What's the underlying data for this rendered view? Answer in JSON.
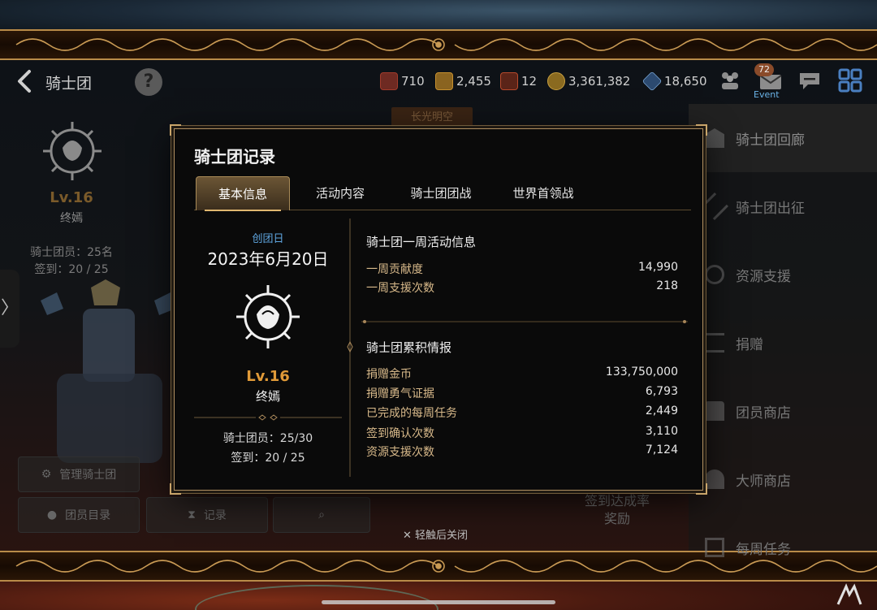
{
  "screen": {
    "back_icon": "chevron-left-icon",
    "title": "骑士团",
    "help_label": "?"
  },
  "resources": [
    {
      "icon": "energy-icon",
      "value": "710",
      "color": "#a23b2b"
    },
    {
      "icon": "crate-icon",
      "value": "2,455",
      "color": "#c7902e"
    },
    {
      "icon": "wave-icon",
      "value": "12",
      "color": "#b84a2c"
    },
    {
      "icon": "gold-coin-icon",
      "value": "3,361,382",
      "color": "#c9a040"
    },
    {
      "icon": "crystal-icon",
      "value": "18,650",
      "color": "#7aa7d6"
    }
  ],
  "topbar_icons": {
    "friends": "friends-icon",
    "mail": "mail-icon",
    "mail_badge": "72",
    "mail_event": "Event",
    "chat": "chat-icon",
    "menu": "grid-menu-icon"
  },
  "left_panel": {
    "level": "Lv.16",
    "name": "终嫣",
    "members": "骑士团员：25名",
    "checkin": "签到：20 / 25"
  },
  "bg_buttons": {
    "manage": "管理骑士团",
    "members": "团员目录",
    "records": "记录",
    "reward": "签到达成率\n奖励",
    "banner": "长光明空"
  },
  "right_menu": [
    {
      "label": "骑士团回廊",
      "icon": "hall-icon"
    },
    {
      "label": "骑士团出征",
      "icon": "crossed-swords-icon"
    },
    {
      "label": "资源支援",
      "icon": "support-icon"
    },
    {
      "label": "捐赠",
      "icon": "donate-icon"
    },
    {
      "label": "团员商店",
      "icon": "shop-icon"
    },
    {
      "label": "大师商店",
      "icon": "master-shop-icon"
    },
    {
      "label": "每周任务",
      "icon": "weekly-task-icon"
    }
  ],
  "modal": {
    "title": "骑士团记录",
    "tabs": [
      "基本信息",
      "活动内容",
      "骑士团团战",
      "世界首领战"
    ],
    "active_tab": 0,
    "card": {
      "founded_label": "创团日",
      "founded_date": "2023年6月20日",
      "level": "Lv.16",
      "name": "终嫣",
      "members": "骑士团员：25/30",
      "checkin": "签到：20 / 25"
    },
    "weekly": {
      "title": "骑士团一周活动信息",
      "rows": [
        {
          "label": "一周贡献度",
          "value": "14,990"
        },
        {
          "label": "一周支援次数",
          "value": "218"
        }
      ]
    },
    "cumulative": {
      "title": "骑士团累积情报",
      "rows": [
        {
          "label": "捐赠金币",
          "value": "133,750,000"
        },
        {
          "label": "捐赠勇气证据",
          "value": "6,793"
        },
        {
          "label": "已完成的每周任务",
          "value": "2,449"
        },
        {
          "label": "签到确认次数",
          "value": "3,110"
        },
        {
          "label": "资源支援次数",
          "value": "7,124"
        }
      ]
    }
  },
  "close_hint": "✕ 轻触后关闭",
  "colors": {
    "gold": "#c9a56a",
    "accent_blue": "#5fa6e0",
    "level_orange": "#e09a38"
  }
}
